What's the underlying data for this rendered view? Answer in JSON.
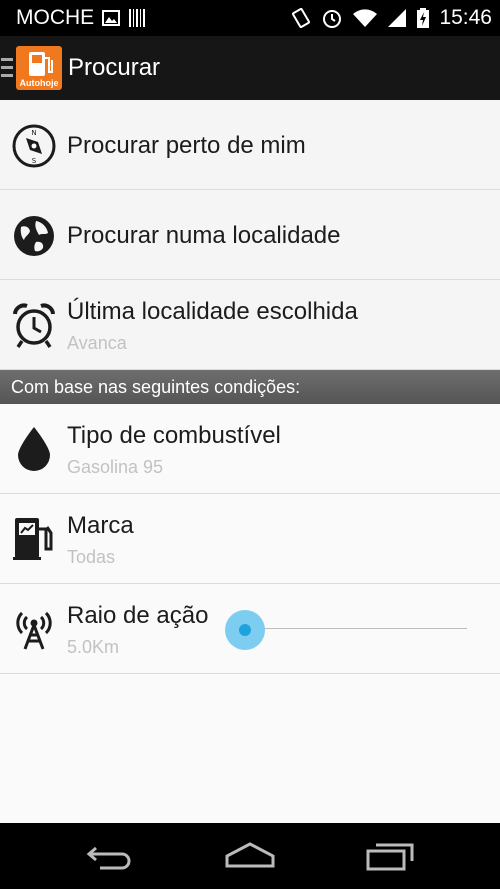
{
  "status_bar": {
    "carrier": "MOCHE",
    "time": "15:46",
    "icons": [
      "image-icon",
      "barcode-icon",
      "vibrate-icon",
      "alarm-icon",
      "wifi-icon",
      "signal-icon",
      "battery-charging-icon"
    ]
  },
  "action_bar": {
    "title": "Procurar",
    "logo_text": "Autohoje",
    "accent_color": "#f0781e"
  },
  "menu": {
    "near_me": {
      "title": "Procurar perto de mim",
      "icon": "compass-icon"
    },
    "locality": {
      "title": "Procurar numa localidade",
      "icon": "globe-icon"
    },
    "last_locality": {
      "title": "Última localidade escolhida",
      "subtitle": "Avanca",
      "icon": "alarm-clock-icon"
    }
  },
  "conditions": {
    "header": "Com base nas seguintes condições:",
    "fuel_type": {
      "title": "Tipo de combustível",
      "value": "Gasolina 95",
      "icon": "drop-icon"
    },
    "brand": {
      "title": "Marca",
      "value": "Todas",
      "icon": "fuel-pump-icon"
    },
    "radius": {
      "title": "Raio de ação",
      "value": "5.0Km",
      "icon": "antenna-icon",
      "slider_fraction": 0.0,
      "slider_color": "#1ea3de"
    }
  },
  "nav_bar": {
    "buttons": [
      "back-icon",
      "home-icon",
      "recents-icon"
    ]
  }
}
